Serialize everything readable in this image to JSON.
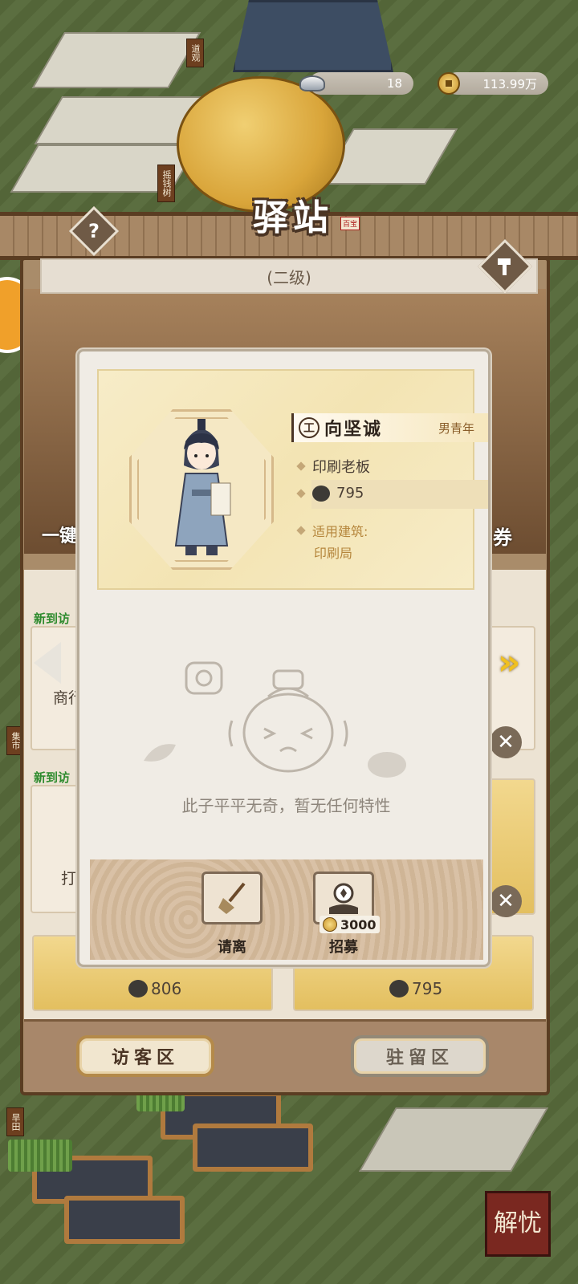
{
  "resources": {
    "silver": "18",
    "copper": "113.99万"
  },
  "station": {
    "title": "驿站",
    "title_seal": "百宝",
    "level": "(二级)",
    "help_symbol": "?"
  },
  "background_labels": {
    "taoist_temple": "道观",
    "money_tree": "摇钱树",
    "market": "集市",
    "dry_field": "旱田",
    "left_button": "一键",
    "right_button": "券"
  },
  "list": {
    "new_tag": "新到访",
    "card_left_top_label": "商行老板",
    "card_left_middle_label": "打",
    "card_bottom_left_value": "806",
    "card_bottom_right_value": "795"
  },
  "tabs": {
    "visitor": "访客区",
    "resident": "驻留区"
  },
  "corner_stamp": "解忧",
  "modal": {
    "name": "向坚诚",
    "job_icon": "工",
    "age_tag": "男青年",
    "occupation": "印刷老板",
    "power": "795",
    "building_label": "适用建筑:",
    "building_value": "印刷局",
    "trait_text": "此子平平无奇，暂无任何特性",
    "dismiss_label": "请离",
    "recruit_label": "招募",
    "recruit_cost": "3000"
  },
  "colors": {
    "panel_brown": "#a98c6a",
    "modal_bg": "#f0ece5",
    "gold_card": "#f3e4b3",
    "new_tag_green": "#2e8b2e"
  },
  "icons": {
    "silver": "silver-ingot-icon",
    "copper": "copper-coin-icon",
    "help": "question-icon",
    "build": "hammer-icon",
    "job": "craftsman-icon",
    "power": "heart-icon",
    "dismiss": "broom-icon",
    "recruit": "coin-hand-icon",
    "close": "close-icon"
  }
}
